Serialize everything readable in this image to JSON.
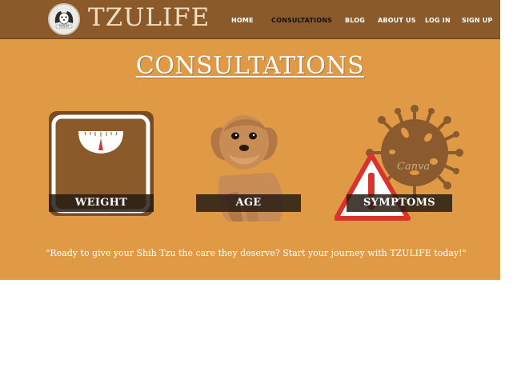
{
  "brand": {
    "name": "TZULIFE",
    "logo_text": "TZULIFE"
  },
  "nav": {
    "items": [
      {
        "label": "HOME"
      },
      {
        "label": "CONSULTATIONS"
      },
      {
        "label": "BLOG"
      },
      {
        "label": "ABOUT US"
      },
      {
        "label": "LOG IN"
      },
      {
        "label": "SIGN UP"
      }
    ],
    "active": "CONSULTATIONS"
  },
  "page_title": "CONSULTATIONS",
  "cards": [
    {
      "label": "WEIGHT",
      "icon": "scale-icon"
    },
    {
      "label": "AGE",
      "icon": "shih-tzu-dog-image"
    },
    {
      "label": "SYMPTOMS",
      "icon": "virus-warning-icon",
      "watermark": "Canva"
    }
  ],
  "quote": "\"Ready to give your Shih Tzu the care they deserve? Start your journey with TZULIFE today!\"",
  "colors": {
    "navbar": "#8a5a2b",
    "page_background": "#e09a46",
    "accent_brown": "#8a5a2b",
    "warning_red": "#d8332c",
    "virus_brown": "#8b5a2e"
  }
}
